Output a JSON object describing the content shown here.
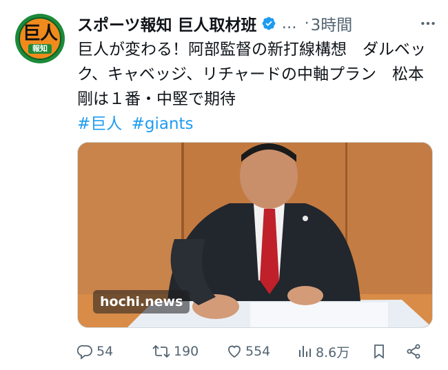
{
  "author": {
    "name": "スポーツ報知 巨人取材班",
    "avatar_main": "巨人",
    "avatar_sub": "報知",
    "verified": true
  },
  "header": {
    "ellipsis": "…",
    "dot": "·",
    "time": "3時間"
  },
  "tweet": {
    "text": "巨人が変わる！阿部監督の新打線構想　ダルベック、キャベッジ、リチャードの中軸プラン　松本剛は１番・中堅で期待",
    "hashtags": [
      "#巨人",
      "#giants"
    ]
  },
  "media": {
    "badge": "hochi.news"
  },
  "actions": {
    "replies": "54",
    "retweets": "190",
    "likes": "554",
    "views": "8.6万"
  },
  "colors": {
    "accent": "#1d9bf0",
    "muted": "#536471",
    "text": "#0f1419"
  }
}
